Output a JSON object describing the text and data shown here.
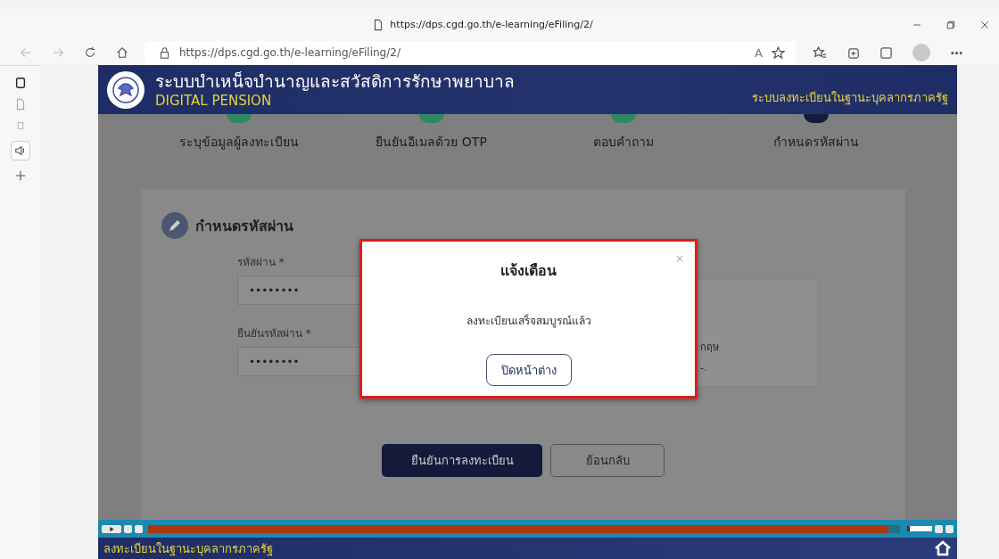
{
  "browser": {
    "title_url": "https://dps.cgd.go.th/e-learning/eFiling/2/",
    "address": "https://dps.cgd.go.th/e-learning/eFiling/2/",
    "read_aloud": "A"
  },
  "header": {
    "title": "ระบบบำเหน็จบำนาญและสวัสดิการรักษาพยาบาล",
    "subtitle": "DIGITAL PENSION",
    "section": "ระบบลงทะเบียนในฐานะบุคลากรภาครัฐ"
  },
  "steps": [
    {
      "label": "ระบุข้อมูลผู้ลงทะเบียน",
      "color": "#2e8a5e"
    },
    {
      "label": "ยืนยันอีเมลด้วย OTP",
      "color": "#2e8a5e"
    },
    {
      "label": "ตอบคำถาม",
      "color": "#2e8a5e"
    },
    {
      "label": "กำหนดรหัสผ่าน",
      "color": "#141c3a"
    }
  ],
  "form": {
    "title": "กำหนดรหัสผ่าน",
    "fields": [
      {
        "label": "รหัสผ่าน *",
        "value": "••••••••"
      },
      {
        "label": "ยืนยันรหัสผ่าน *",
        "value": "••••••••"
      }
    ],
    "info_fragments": [
      "กฤษ",
      "-."
    ],
    "buttons": [
      {
        "label": "ยืนยันการลงทะเบียน",
        "kind": "primary"
      },
      {
        "label": "ย้อนกลับ",
        "kind": "secondary"
      }
    ]
  },
  "dialog": {
    "title": "แจ้งเตือน",
    "close": "×",
    "message": "ลงทะเบียนเสร็จสมบูรณ์แล้ว",
    "button": "ปิดหน้าต่าง"
  },
  "player": {
    "progress": {
      "level": 0.985
    },
    "volume": {
      "level": 0.9
    }
  },
  "footer": {
    "text": "ลงทะเบียนในฐานะบุคลากรภาครัฐ"
  }
}
